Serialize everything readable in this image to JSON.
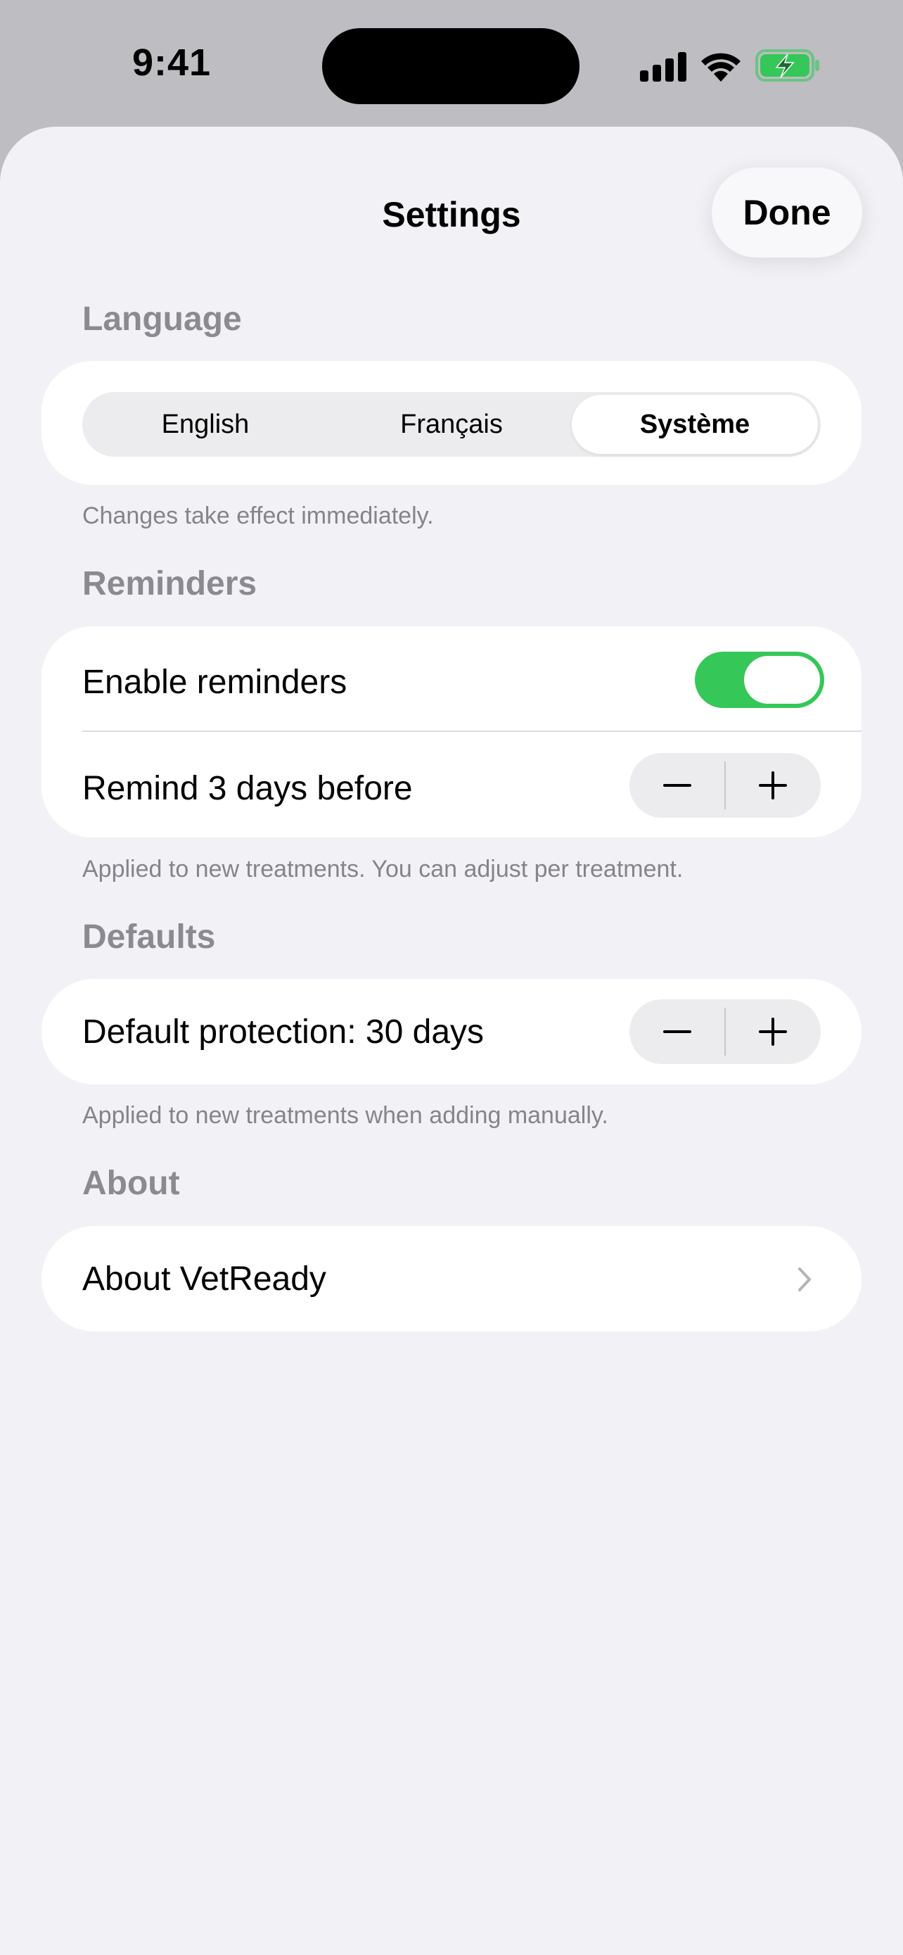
{
  "status_bar": {
    "time": "9:41",
    "icons": [
      "cellular-signal-icon",
      "wifi-icon",
      "battery-charging-icon"
    ],
    "battery_color": "#35c758"
  },
  "nav": {
    "title": "Settings",
    "done_label": "Done"
  },
  "language": {
    "header": "Language",
    "options": [
      "English",
      "Français",
      "Système"
    ],
    "selected": "Système",
    "footnote": "Changes take effect immediately."
  },
  "reminders": {
    "header": "Reminders",
    "enable_label": "Enable reminders",
    "enabled": true,
    "remind_label": "Remind 3 days before",
    "footnote": "Applied to new treatments. You can adjust per treatment."
  },
  "defaults": {
    "header": "Defaults",
    "protection_label": "Default protection: 30 days",
    "footnote": "Applied to new treatments when adding manually."
  },
  "about": {
    "header": "About",
    "about_label": "About VetReady"
  },
  "colors": {
    "accent_green": "#35c758",
    "background": "#f2f1f6",
    "secondary_text": "#8b8a90"
  }
}
